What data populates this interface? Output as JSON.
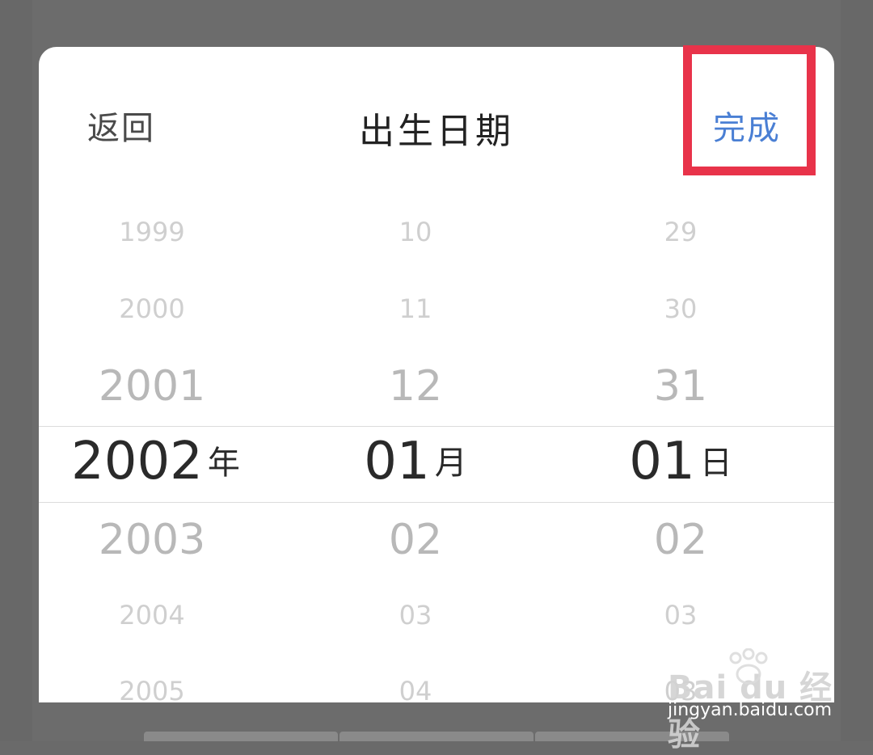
{
  "header": {
    "back_label": "返回",
    "title": "出生日期",
    "done_label": "完成"
  },
  "picker": {
    "year": {
      "items": [
        "1999",
        "2000",
        "2001",
        "2002",
        "2003",
        "2004",
        "2005"
      ],
      "selected": "2002",
      "unit": "年"
    },
    "month": {
      "items": [
        "10",
        "11",
        "12",
        "01",
        "02",
        "03",
        "04"
      ],
      "selected": "01",
      "unit": "月"
    },
    "day": {
      "items": [
        "29",
        "30",
        "31",
        "01",
        "02",
        "03",
        "03"
      ],
      "selected": "01",
      "unit": "日"
    }
  },
  "watermark": {
    "logo_text": "Bai du 经验",
    "url": "jingyan.baidu.com"
  },
  "colors": {
    "accent": "#4a7fd4",
    "highlight": "#e8334a",
    "sheet": "#ffffff",
    "backdrop": "#686868"
  }
}
